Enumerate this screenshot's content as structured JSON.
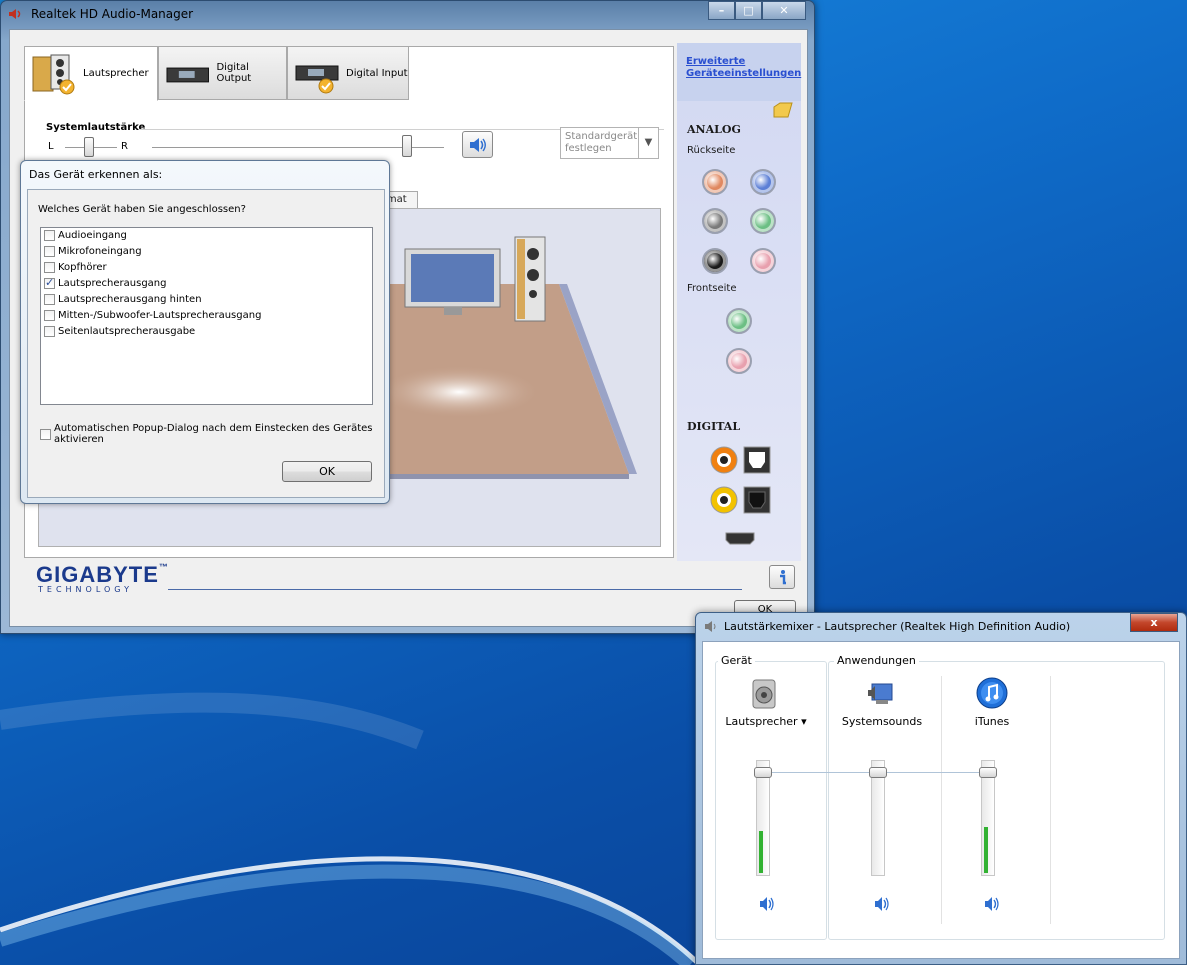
{
  "realtek": {
    "title": "Realtek HD Audio-Manager",
    "tabs": [
      {
        "label": "Lautsprecher"
      },
      {
        "label": "Digital Output"
      },
      {
        "label": "Digital Input"
      }
    ],
    "system_volume": {
      "label": "Systemlautstärke",
      "balance_left": "L",
      "balance_right": "R"
    },
    "default_device": {
      "label": "Standardgerät festlegen"
    },
    "subtab_fragment": "rmat",
    "sidebar": {
      "advanced_link": "Erweiterte Geräteeinstellungen",
      "analog": "ANALOG",
      "rear": "Rückseite",
      "front": "Frontseite",
      "digital": "DIGITAL",
      "jack_colors": [
        "#e08860",
        "#5c7fd6",
        "#7a7a7a",
        "#6cbf84",
        "#1a1a1a",
        "#e8a0ae",
        "#6cbf84",
        "#e8a0ae"
      ]
    },
    "brand": {
      "name": "GIGABYTE",
      "tm": "™",
      "sub": "TECHNOLOGY"
    },
    "ok_partial": "OK"
  },
  "popup": {
    "title": "Das Gerät erkennen als:",
    "question": "Welches Gerät haben Sie angeschlossen?",
    "options": [
      {
        "label": "Audioeingang",
        "checked": false
      },
      {
        "label": "Mikrofoneingang",
        "checked": false
      },
      {
        "label": "Kopfhörer",
        "checked": false
      },
      {
        "label": "Lautsprecherausgang",
        "checked": true
      },
      {
        "label": "Lautsprecherausgang hinten",
        "checked": false
      },
      {
        "label": "Mitten-/Subwoofer-Lautsprecherausgang",
        "checked": false
      },
      {
        "label": "Seitenlautsprecherausgabe",
        "checked": false
      }
    ],
    "auto_popup": {
      "label_line1": "Automatischen Popup-Dialog nach dem Einstecken des Gerätes",
      "label_line2": "aktivieren",
      "checked": false
    },
    "ok": "OK"
  },
  "mixer": {
    "title": "Lautstärkemixer - Lautsprecher (Realtek High Definition Audio)",
    "close": "x",
    "device_group": "Gerät",
    "apps_group": "Anwendungen",
    "channels": [
      {
        "name": "Lautsprecher",
        "icon": "speaker-icon",
        "level": 0.38,
        "dropdown": true
      },
      {
        "name": "Systemsounds",
        "icon": "system-sounds-icon",
        "level": 0.0,
        "dropdown": false
      },
      {
        "name": "iTunes",
        "icon": "itunes-icon",
        "level": 0.42,
        "dropdown": false
      }
    ]
  }
}
